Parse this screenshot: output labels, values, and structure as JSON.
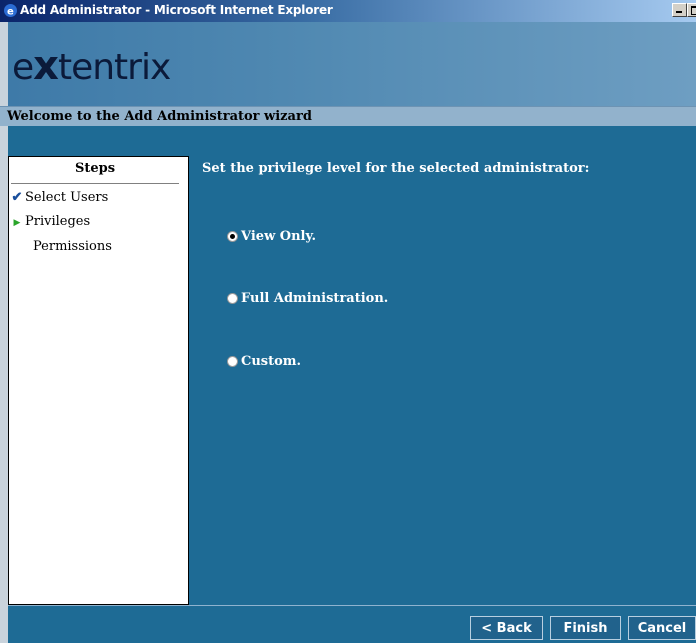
{
  "window": {
    "title": "Add Administrator - Microsoft Internet Explorer",
    "controls": [
      "minimize",
      "maximize"
    ]
  },
  "brand": {
    "logo_prefix": "e",
    "logo_x": "x",
    "logo_rest": "tentrix",
    "accent_color": "#1e6b95"
  },
  "wizard": {
    "title": "Welcome to the Add Administrator wizard",
    "prompt": "Set the privilege level for the selected administrator:",
    "steps_heading": "Steps",
    "steps": [
      {
        "label": "Select Users",
        "status": "done",
        "icon": "check-icon"
      },
      {
        "label": "Privileges",
        "status": "current",
        "icon": "arrow-right-icon"
      },
      {
        "label": "Permissions",
        "status": "pending",
        "icon": ""
      }
    ],
    "options": [
      {
        "label": "View Only.",
        "selected": true
      },
      {
        "label": "Full Administration.",
        "selected": false
      },
      {
        "label": "Custom.",
        "selected": false
      }
    ]
  },
  "footer": {
    "back_label": "< Back",
    "finish_label": "Finish",
    "cancel_label": "Cancel"
  }
}
